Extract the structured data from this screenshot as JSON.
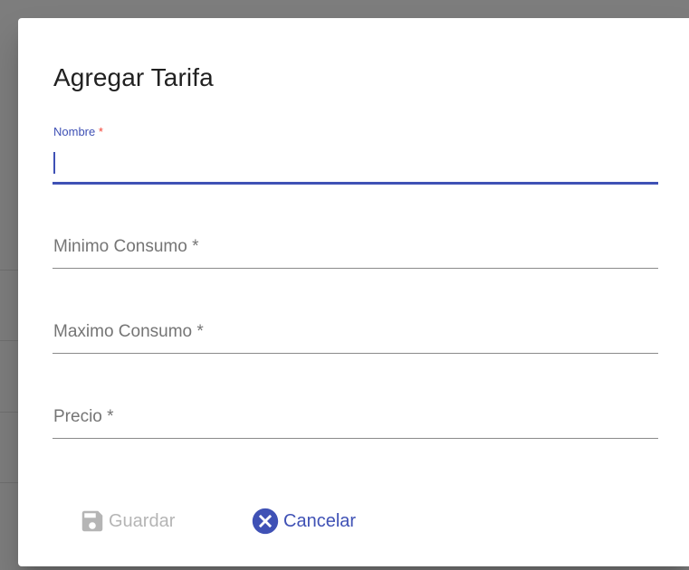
{
  "dialog": {
    "title": "Agregar Tarifa"
  },
  "fields": {
    "nombre": {
      "label": "Nombre",
      "required_mark": "*",
      "value": ""
    },
    "minimo": {
      "placeholder": "Minimo Consumo *",
      "value": ""
    },
    "maximo": {
      "placeholder": "Maximo Consumo *",
      "value": ""
    },
    "precio": {
      "placeholder": "Precio *",
      "value": ""
    }
  },
  "actions": {
    "save_label": "Guardar",
    "save_icon": "floppy-disk-icon",
    "save_disabled": true,
    "cancel_label": "Cancelar",
    "cancel_icon": "cancel-circle-icon"
  },
  "colors": {
    "primary": "#3f51b5",
    "required": "#f44336",
    "disabled": "#b5b5b5"
  }
}
